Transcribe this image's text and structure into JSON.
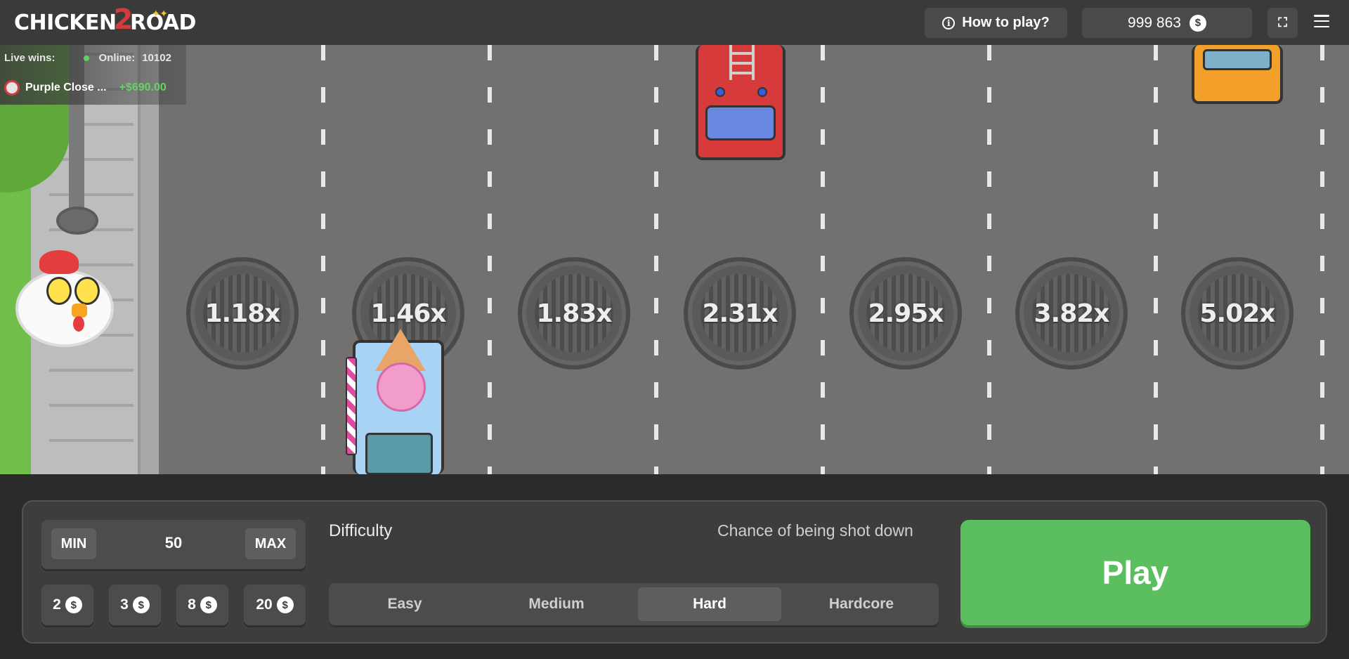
{
  "header": {
    "logo_left": "CHICKEN",
    "logo_num": "2",
    "logo_right": "ROAD",
    "how_to_play": "How to play?",
    "balance": "999 863",
    "currency_symbol": "$"
  },
  "live": {
    "label": "Live wins:",
    "online_label": "Online:",
    "online_count": "10102",
    "last_win_user": "Purple Close ...",
    "last_win_amount": "+$690.00"
  },
  "multipliers": [
    "1.18x",
    "1.46x",
    "1.83x",
    "2.31x",
    "2.95x",
    "3.82x",
    "5.02x"
  ],
  "bet": {
    "min_label": "MIN",
    "max_label": "MAX",
    "value": "50",
    "chips": [
      "2",
      "3",
      "8",
      "20"
    ]
  },
  "difficulty": {
    "label": "Difficulty",
    "chance_label": "Chance of being shot down",
    "options": [
      "Easy",
      "Medium",
      "Hard",
      "Hardcore"
    ],
    "selected": "Hard"
  },
  "play_label": "Play",
  "colors": {
    "accent_green": "#5cbf5f",
    "road": "#737170",
    "panel": "#3d3d3d",
    "win_green": "#64d364"
  }
}
